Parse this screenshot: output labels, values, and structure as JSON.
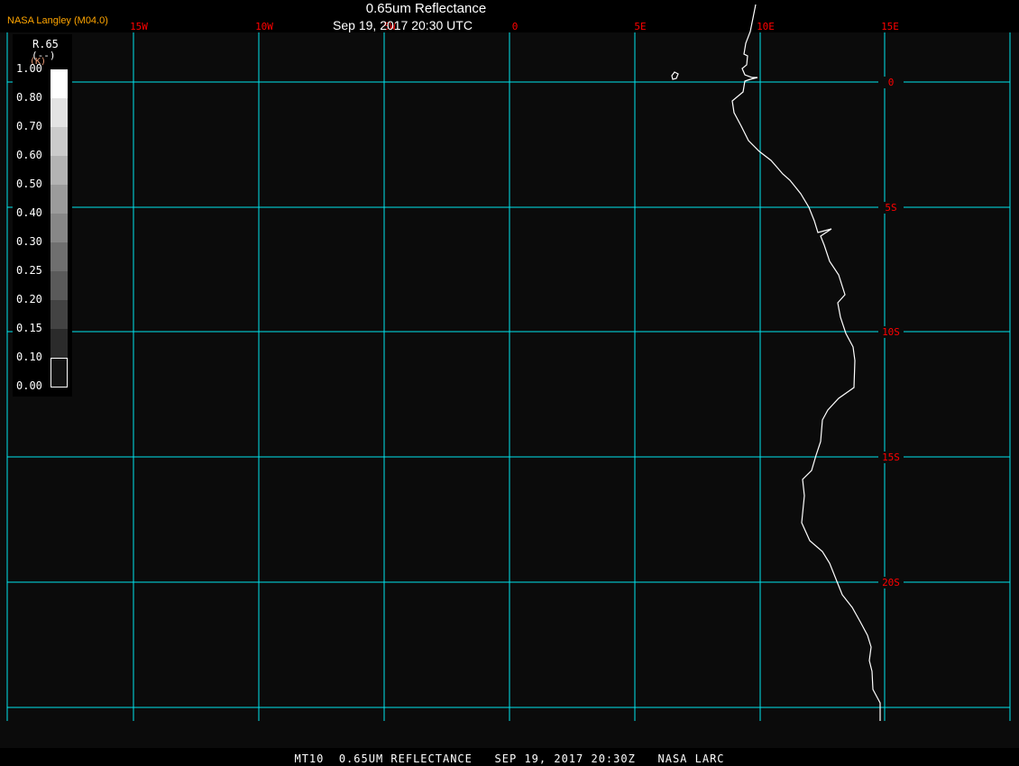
{
  "header": {
    "title": "0.65um Reflectance",
    "subtitle": "Sep 19, 2017 20:30 UTC",
    "credit": "NASA Langley (M04.0)"
  },
  "legend": {
    "title": "R.65",
    "unit": "(--)",
    "unit2": "(K)",
    "ticks": [
      "1.00",
      "0.80",
      "0.70",
      "0.60",
      "0.50",
      "0.40",
      "0.30",
      "0.25",
      "0.20",
      "0.15",
      "0.10",
      "0.00"
    ],
    "colors": [
      "#ffffff",
      "#e3e3e3",
      "#cbcbcb",
      "#b3b3b3",
      "#9b9b9b",
      "#878787",
      "#6f6f6f",
      "#5a5a5a",
      "#434343",
      "#2b2b2b",
      "#121212"
    ]
  },
  "map": {
    "lon_labels": [
      "15W",
      "10W",
      "5W",
      "0",
      "5E",
      "10E",
      "15E"
    ],
    "lat_labels": [
      "0",
      "5S",
      "10S",
      "15S",
      "20S"
    ],
    "grid_color": "#00e5ee",
    "label_color": "#ff0000",
    "coast_color": "#ffffff",
    "background": "#0b0b0b"
  },
  "footer": "MT10  0.65UM REFLECTANCE   SEP 19, 2017 20:30Z   NASA LARC"
}
